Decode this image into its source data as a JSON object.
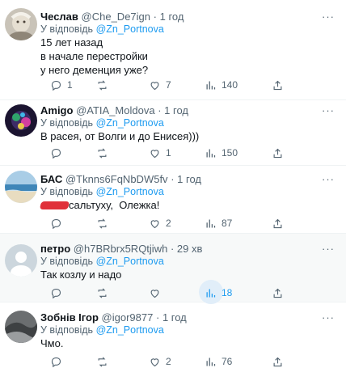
{
  "tweets": [
    {
      "name": "Чеслав",
      "handle": "@Che_De7ign",
      "time": "1 год",
      "reply_prefix": "У відповідь",
      "reply_mention": "@Zn_Portnova",
      "lines": [
        "15 лет назад",
        "в начале перестройки",
        "у него деменция уже?"
      ],
      "counts": {
        "reply": "1",
        "retweet": "",
        "like": "7",
        "views": "140"
      }
    },
    {
      "name": "Amigo",
      "handle": "@ATIA_Moldova",
      "time": "1 год",
      "reply_prefix": "У відповідь",
      "reply_mention": "@Zn_Portnova",
      "lines": [
        "В расея, от Волги и до Енисея)))"
      ],
      "counts": {
        "reply": "",
        "retweet": "",
        "like": "1",
        "views": "150"
      }
    },
    {
      "name": "БАС",
      "handle": "@Tknns6FqNbDW5fv",
      "time": "1 год",
      "reply_prefix": "У відповідь",
      "reply_mention": "@Zn_Portnova",
      "lines": [
        "сальтуху,  Олежка!"
      ],
      "counts": {
        "reply": "",
        "retweet": "",
        "like": "2",
        "views": "87"
      }
    },
    {
      "name": "петро",
      "handle": "@h7BRbrx5RQtjiwh",
      "time": "29 хв",
      "reply_prefix": "У відповідь",
      "reply_mention": "@Zn_Portnova",
      "lines": [
        "Так козлу и надо"
      ],
      "counts": {
        "reply": "",
        "retweet": "",
        "like": "",
        "views": "18"
      }
    },
    {
      "name": "Зобнів Ігор",
      "handle": "@igor9877",
      "time": "1 год",
      "reply_prefix": "У відповідь",
      "reply_mention": "@Zn_Portnova",
      "lines": [
        "Чмо."
      ],
      "counts": {
        "reply": "",
        "retweet": "",
        "like": "2",
        "views": "76"
      }
    }
  ],
  "colors": {
    "accent": "#1d9bf0",
    "muted": "#536471",
    "highlight_bg": "#f7f9f9"
  },
  "icons": [
    "reply-icon",
    "retweet-icon",
    "like-icon",
    "views-icon",
    "share-icon",
    "more-icon"
  ]
}
